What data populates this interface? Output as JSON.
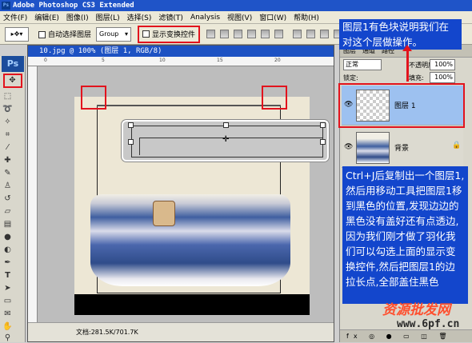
{
  "window": {
    "title": "Adobe Photoshop CS3 Extended",
    "app_badge": "Ps"
  },
  "menu": [
    "文件(F)",
    "编辑(E)",
    "图像(I)",
    "图层(L)",
    "选择(S)",
    "滤镜(T)",
    "Analysis",
    "视图(V)",
    "窗口(W)",
    "帮助(H)"
  ],
  "options": {
    "auto_select_label": "自动选择图层",
    "auto_select_value": "Group",
    "show_transform_label": "显示变换控件"
  },
  "document": {
    "tab_title": "10.jpg @ 100% (图层 1, RGB/8)",
    "status": "文档:281.5K/701.7K",
    "ruler_ticks": [
      "0",
      "5",
      "10",
      "15",
      "20"
    ]
  },
  "layers_panel": {
    "tabs": [
      "图层",
      "通道",
      "路径"
    ],
    "blend_mode": "正常",
    "opacity_label": "不透明度:",
    "opacity_value": "100%",
    "lock_label": "锁定:",
    "fill_label": "填充:",
    "fill_value": "100%",
    "layers": [
      {
        "name": "图层 1",
        "selected": true
      },
      {
        "name": "背景",
        "selected": false
      }
    ],
    "bottom_icons": "fx ◎ ● ▭ ◫ 🗑"
  },
  "annotations": {
    "top_note": "图层1有色块说明我们在对这个层做操作。",
    "main_note": "Ctrl+J后复制出一个图层1,然后用移动工具把图层1移到黑色的位置,发现边边的黑色没有盖好还有点透边,因为我们刚才做了羽化我们可以勾选上面的显示变换控件,然后把图层1的边拉长点,全部盖住黑色"
  },
  "watermark": {
    "line1": "资源批发网",
    "line2": "www.6pf.cn"
  },
  "colors": {
    "title_blue": "#1f54c8",
    "note_blue": "#1346cc",
    "highlight_red": "#e2131d"
  }
}
